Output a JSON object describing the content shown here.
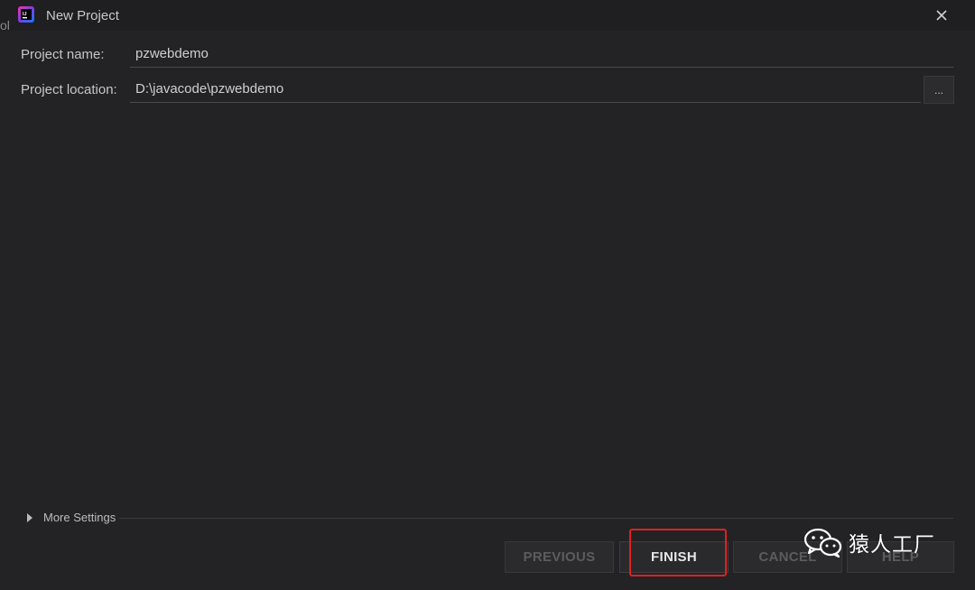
{
  "window": {
    "title": "New Project",
    "side_char": "ol"
  },
  "form": {
    "project_name_label": "Project name:",
    "project_name_value": "pzwebdemo",
    "project_location_label": "Project location:",
    "project_location_value": "D:\\javacode\\pzwebdemo",
    "browse_label": "..."
  },
  "more_settings": {
    "label": "More Settings"
  },
  "buttons": {
    "previous": "PREVIOUS",
    "finish": "FINISH",
    "cancel": "CANCEL",
    "help": "HELP"
  },
  "watermark": {
    "text": "猿人工厂"
  },
  "colors": {
    "background": "#232325",
    "highlight": "#e02020",
    "app_icon": "#7b3fe4"
  }
}
